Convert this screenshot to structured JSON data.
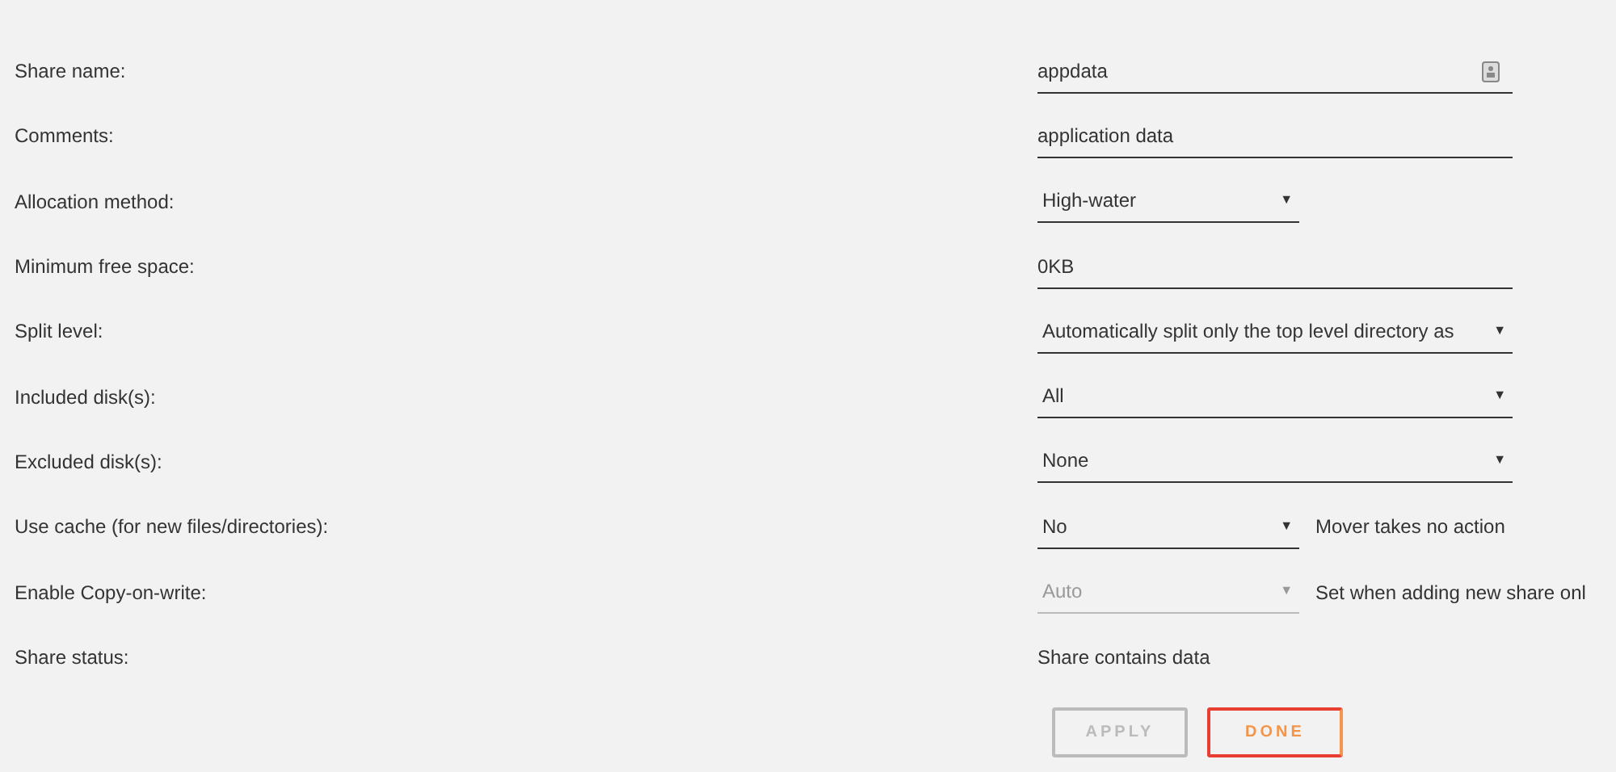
{
  "settings": [
    {
      "label": "Share name:",
      "kind": "input",
      "value": "appdata",
      "narrow": false,
      "has_icon": true
    },
    {
      "label": "Comments:",
      "kind": "input",
      "value": "application data",
      "narrow": false
    },
    {
      "label": "Allocation method:",
      "kind": "select",
      "value": "High-water",
      "caret": "▼",
      "narrow": true
    },
    {
      "label": "Minimum free space:",
      "kind": "input",
      "value": "0KB",
      "narrow": false
    },
    {
      "label": "Split level:",
      "kind": "select",
      "value": "Automatically split only the top level directory as",
      "caret": "▼",
      "narrow": false
    },
    {
      "label": "Included disk(s):",
      "kind": "select",
      "value": "All",
      "caret": "▼",
      "narrow": false
    },
    {
      "label": "Excluded disk(s):",
      "kind": "select",
      "value": "None",
      "caret": "▼",
      "narrow": false
    },
    {
      "label": "Use cache (for new files/directories):",
      "kind": "select",
      "value": "No",
      "caret": "▼",
      "narrow": true,
      "note": "Mover takes no action"
    },
    {
      "label": "Enable Copy-on-write:",
      "kind": "select",
      "value": "Auto",
      "caret": "▼",
      "narrow": true,
      "disabled": true,
      "note": "Set when adding new share onl"
    },
    {
      "label": "Share status:",
      "kind": "text",
      "value": "Share contains data"
    }
  ],
  "buttons": [
    {
      "label": "APPLY",
      "disabled": true
    },
    {
      "label": "DONE",
      "disabled": false
    }
  ]
}
